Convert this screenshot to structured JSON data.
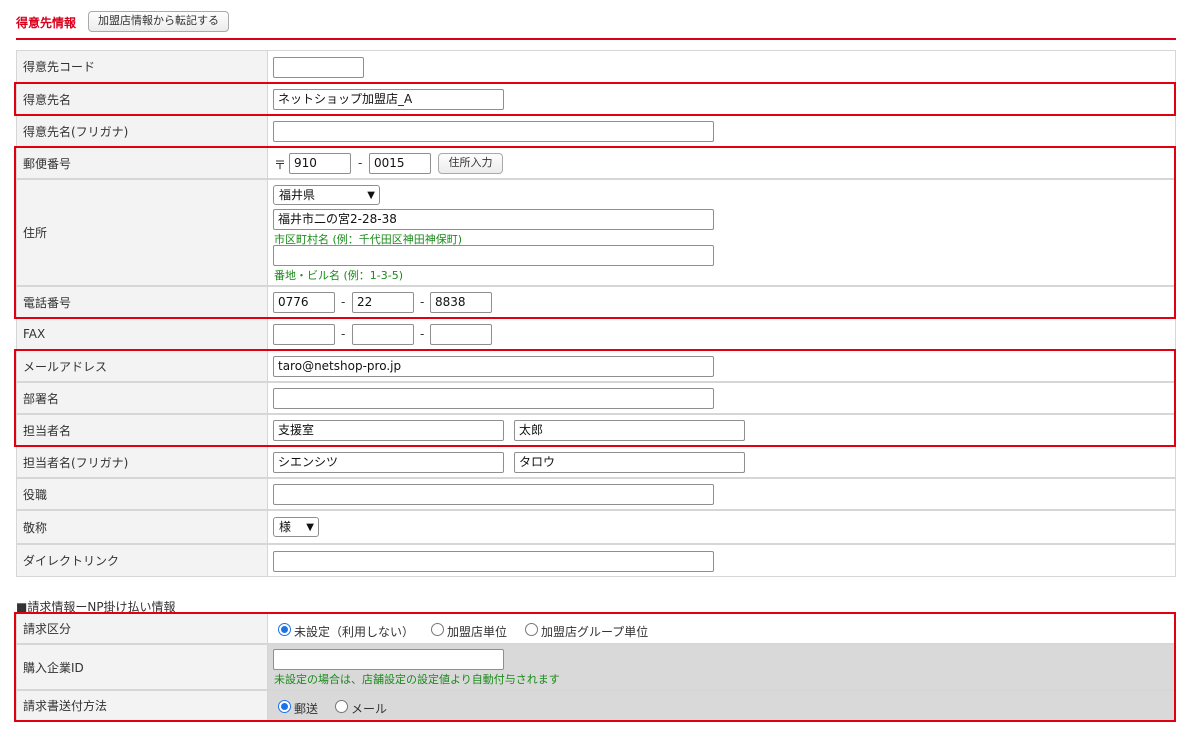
{
  "header": {
    "title": "得意先情報",
    "copy_button": "加盟店情報から転記する"
  },
  "fields": {
    "code": {
      "label": "得意先コード",
      "value": ""
    },
    "name": {
      "label": "得意先名",
      "value": "ネットショップ加盟店_A"
    },
    "kana": {
      "label": "得意先名(フリガナ)",
      "value": ""
    },
    "postal": {
      "label": "郵便番号",
      "mark": "〒",
      "part1": "910",
      "sep": "-",
      "part2": "0015",
      "button": "住所入力"
    },
    "address": {
      "label": "住所",
      "prefecture": "福井県",
      "city": "福井市二の宮2-28-38",
      "city_hint": "市区町村名 (例：千代田区神田神保町)",
      "street": "",
      "street_hint": "番地・ビル名 (例：1-3-5)"
    },
    "phone": {
      "label": "電話番号",
      "part1": "0776",
      "part2": "22",
      "part3": "8838",
      "sep": "-"
    },
    "fax": {
      "label": "FAX",
      "part1": "",
      "part2": "",
      "part3": "",
      "sep": "-"
    },
    "email": {
      "label": "メールアドレス",
      "value": "taro@netshop-pro.jp"
    },
    "department": {
      "label": "部署名",
      "value": ""
    },
    "contact": {
      "label": "担当者名",
      "last": "支援室",
      "first": "太郎"
    },
    "contact_kana": {
      "label": "担当者名(フリガナ)",
      "last": "シエンシツ",
      "first": "タロウ"
    },
    "position": {
      "label": "役職",
      "value": ""
    },
    "honorific": {
      "label": "敬称",
      "value": "様"
    },
    "direct_link": {
      "label": "ダイレクトリンク",
      "value": ""
    }
  },
  "billing": {
    "section_title": "■請求情報ーNP掛け払い情報",
    "type": {
      "label": "請求区分",
      "options": [
        "未設定（利用しない）",
        "加盟店単位",
        "加盟店グループ単位"
      ],
      "selected": 0
    },
    "company_id": {
      "label": "購入企業ID",
      "value": "",
      "hint": "未設定の場合は、店舗設定の設定値より自動付与されます"
    },
    "send_method": {
      "label": "請求書送付方法",
      "options": [
        "郵送",
        "メール"
      ],
      "selected": 0
    }
  },
  "colors": {
    "accent": "#d9001b",
    "highlight": "#e0000f",
    "hint": "#1a8a1a",
    "radio": "#1a73e8"
  }
}
